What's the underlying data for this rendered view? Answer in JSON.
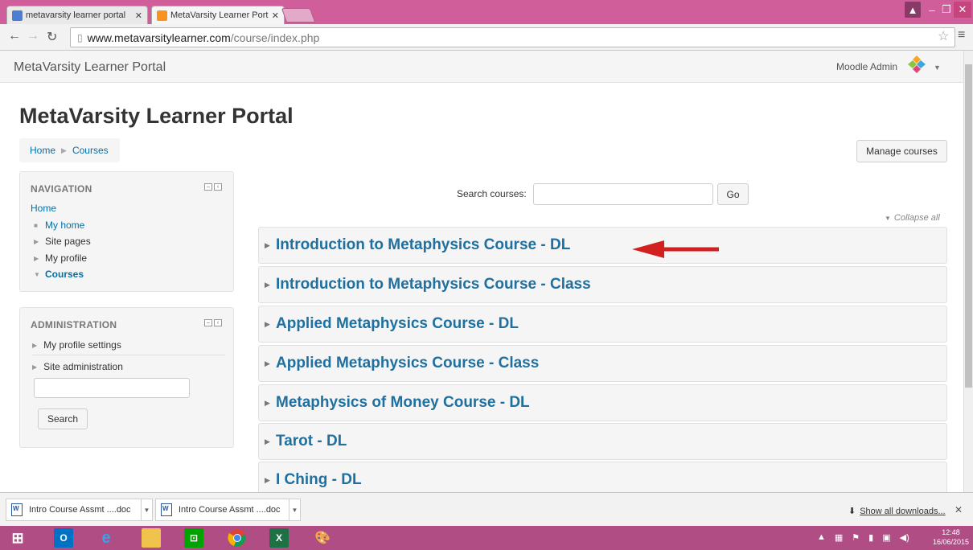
{
  "browser": {
    "tabs": [
      {
        "title": "metavarsity learner portal",
        "active": false
      },
      {
        "title": "MetaVarsity Learner Porta",
        "active": true
      }
    ],
    "address": {
      "host": "www.metavarsitylearner.com",
      "path": "/course/index.php"
    },
    "colors": {
      "titlebar": "#d05e9a",
      "taskbar": "#b04d85"
    }
  },
  "header": {
    "brand": "MetaVarsity Learner Portal",
    "user": "Moodle Admin"
  },
  "page": {
    "heading": "MetaVarsity Learner Portal",
    "breadcrumb": [
      "Home",
      "Courses"
    ],
    "manage_button": "Manage courses"
  },
  "navigation": {
    "title": "NAVIGATION",
    "home": "Home",
    "items": [
      {
        "label": "My home",
        "bullet": "square"
      },
      {
        "label": "Site pages",
        "bullet": "triangle-right"
      },
      {
        "label": "My profile",
        "bullet": "triangle-right"
      },
      {
        "label": "Courses",
        "bullet": "triangle-down"
      }
    ]
  },
  "administration": {
    "title": "ADMINISTRATION",
    "items": [
      "My profile settings",
      "Site administration"
    ],
    "search_button": "Search"
  },
  "course_search": {
    "label": "Search courses:",
    "button": "Go",
    "collapse_all": "Collapse all"
  },
  "courses": [
    "Introduction to Metaphysics Course - DL",
    "Introduction to Metaphysics Course - Class",
    "Applied Metaphysics Course - DL",
    "Applied Metaphysics Course - Class",
    "Metaphysics of Money Course - DL",
    "Tarot - DL",
    "I Ching - DL"
  ],
  "downloads": {
    "items": [
      "Intro Course Assmt ....doc",
      "Intro Course Assmt ....doc"
    ],
    "show_all": "Show all downloads..."
  },
  "taskbar": {
    "time": "12:48",
    "date": "16/06/2015"
  }
}
